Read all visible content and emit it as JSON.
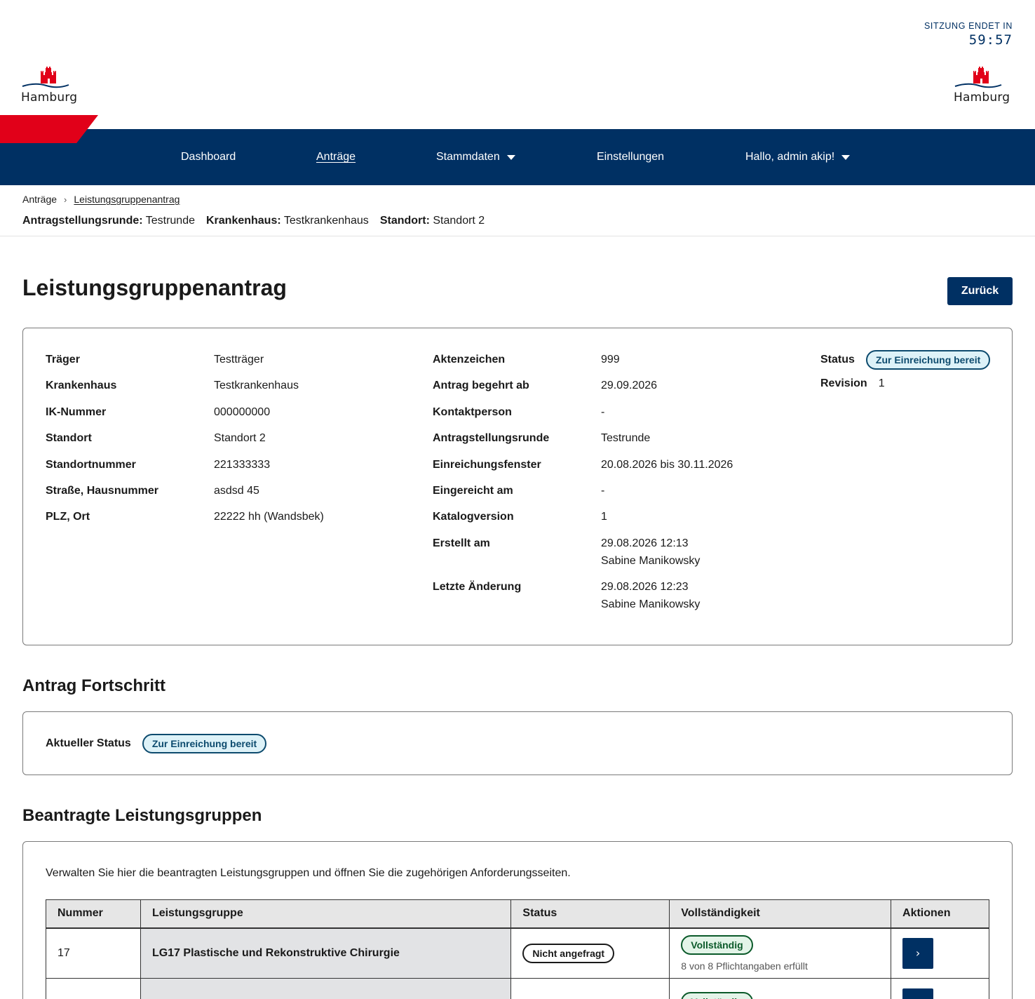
{
  "session": {
    "label": "SITZUNG ENDET IN",
    "time": "59:57"
  },
  "logo": {
    "text": "Hamburg"
  },
  "nav": {
    "dashboard": "Dashboard",
    "antraege": "Anträge",
    "stammdaten": "Stammdaten",
    "einstellungen": "Einstellungen",
    "user": "Hallo, admin akip!"
  },
  "breadcrumb": {
    "root": "Anträge",
    "current": "Leistungsgruppenantrag"
  },
  "context": {
    "runde_label": "Antragstellungsrunde:",
    "runde_value": "Testrunde",
    "kh_label": "Krankenhaus:",
    "kh_value": "Testkrankenhaus",
    "standort_label": "Standort:",
    "standort_value": "Standort 2"
  },
  "page": {
    "title": "Leistungsgruppenantrag",
    "back": "Zurück"
  },
  "info": {
    "col1": [
      {
        "k": "Träger",
        "v": "Testträger"
      },
      {
        "k": "Krankenhaus",
        "v": "Testkrankenhaus"
      },
      {
        "k": "IK-Nummer",
        "v": "000000000"
      },
      {
        "k": "Standort",
        "v": "Standort 2"
      },
      {
        "k": "Standortnummer",
        "v": "221333333"
      },
      {
        "k": "Straße, Hausnummer",
        "v": "asdsd 45"
      },
      {
        "k": "PLZ, Ort",
        "v": "22222 hh (Wandsbek)"
      }
    ],
    "col2": [
      {
        "k": "Aktenzeichen",
        "v": "999"
      },
      {
        "k": "Antrag begehrt ab",
        "v": "29.09.2026"
      },
      {
        "k": "Kontaktperson",
        "v": "-"
      },
      {
        "k": "Antragstellungsrunde",
        "v": "Testrunde"
      },
      {
        "k": "Einreichungsfenster",
        "v": "20.08.2026 bis 30.11.2026"
      },
      {
        "k": "Eingereicht am",
        "v": "-"
      },
      {
        "k": "Katalogversion",
        "v": "1"
      },
      {
        "k": "Erstellt am",
        "v": "29.08.2026 12:13",
        "v2": "Sabine Manikowsky"
      },
      {
        "k": "Letzte Änderung",
        "v": "29.08.2026 12:23",
        "v2": "Sabine Manikowsky"
      }
    ],
    "status_label": "Status",
    "status_value": "Zur Einreichung bereit",
    "revision_label": "Revision",
    "revision_value": "1"
  },
  "progress": {
    "title": "Antrag Fortschritt",
    "label": "Aktueller Status",
    "value": "Zur Einreichung bereit"
  },
  "groups": {
    "title": "Beantragte Leistungsgruppen",
    "intro": "Verwalten Sie hier die beantragten Leistungsgruppen und öffnen Sie die zugehörigen Anforderungsseiten.",
    "headers": [
      "Nummer",
      "Leistungsgruppe",
      "Status",
      "Vollständigkeit",
      "Aktionen"
    ],
    "rows": [
      {
        "nummer": "17",
        "name": "LG17 Plastische und Rekonstruktive Chirurgie",
        "status": "Nicht angefragt",
        "complete": "Vollständig",
        "complete_sub": "8 von 8 Pflichtangaben erfüllt",
        "action": "›"
      },
      {
        "nummer": "",
        "name": "",
        "status": "",
        "complete": "Vollständig",
        "complete_sub": "",
        "action": "›"
      }
    ]
  },
  "colors": {
    "primary": "#003063",
    "accent": "#e10019"
  }
}
